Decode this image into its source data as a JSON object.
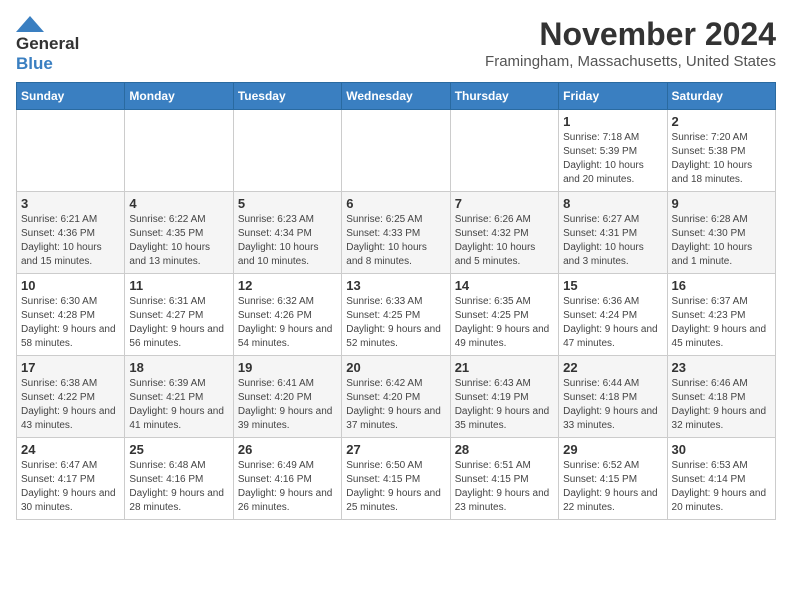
{
  "header": {
    "logo_line1": "General",
    "logo_line2": "Blue",
    "month_year": "November 2024",
    "location": "Framingham, Massachusetts, United States"
  },
  "weekdays": [
    "Sunday",
    "Monday",
    "Tuesday",
    "Wednesday",
    "Thursday",
    "Friday",
    "Saturday"
  ],
  "weeks": [
    [
      {
        "day": "",
        "sunrise": "",
        "sunset": "",
        "daylight": ""
      },
      {
        "day": "",
        "sunrise": "",
        "sunset": "",
        "daylight": ""
      },
      {
        "day": "",
        "sunrise": "",
        "sunset": "",
        "daylight": ""
      },
      {
        "day": "",
        "sunrise": "",
        "sunset": "",
        "daylight": ""
      },
      {
        "day": "",
        "sunrise": "",
        "sunset": "",
        "daylight": ""
      },
      {
        "day": "1",
        "sunrise": "Sunrise: 7:18 AM",
        "sunset": "Sunset: 5:39 PM",
        "daylight": "Daylight: 10 hours and 20 minutes."
      },
      {
        "day": "2",
        "sunrise": "Sunrise: 7:20 AM",
        "sunset": "Sunset: 5:38 PM",
        "daylight": "Daylight: 10 hours and 18 minutes."
      }
    ],
    [
      {
        "day": "3",
        "sunrise": "Sunrise: 6:21 AM",
        "sunset": "Sunset: 4:36 PM",
        "daylight": "Daylight: 10 hours and 15 minutes."
      },
      {
        "day": "4",
        "sunrise": "Sunrise: 6:22 AM",
        "sunset": "Sunset: 4:35 PM",
        "daylight": "Daylight: 10 hours and 13 minutes."
      },
      {
        "day": "5",
        "sunrise": "Sunrise: 6:23 AM",
        "sunset": "Sunset: 4:34 PM",
        "daylight": "Daylight: 10 hours and 10 minutes."
      },
      {
        "day": "6",
        "sunrise": "Sunrise: 6:25 AM",
        "sunset": "Sunset: 4:33 PM",
        "daylight": "Daylight: 10 hours and 8 minutes."
      },
      {
        "day": "7",
        "sunrise": "Sunrise: 6:26 AM",
        "sunset": "Sunset: 4:32 PM",
        "daylight": "Daylight: 10 hours and 5 minutes."
      },
      {
        "day": "8",
        "sunrise": "Sunrise: 6:27 AM",
        "sunset": "Sunset: 4:31 PM",
        "daylight": "Daylight: 10 hours and 3 minutes."
      },
      {
        "day": "9",
        "sunrise": "Sunrise: 6:28 AM",
        "sunset": "Sunset: 4:30 PM",
        "daylight": "Daylight: 10 hours and 1 minute."
      }
    ],
    [
      {
        "day": "10",
        "sunrise": "Sunrise: 6:30 AM",
        "sunset": "Sunset: 4:28 PM",
        "daylight": "Daylight: 9 hours and 58 minutes."
      },
      {
        "day": "11",
        "sunrise": "Sunrise: 6:31 AM",
        "sunset": "Sunset: 4:27 PM",
        "daylight": "Daylight: 9 hours and 56 minutes."
      },
      {
        "day": "12",
        "sunrise": "Sunrise: 6:32 AM",
        "sunset": "Sunset: 4:26 PM",
        "daylight": "Daylight: 9 hours and 54 minutes."
      },
      {
        "day": "13",
        "sunrise": "Sunrise: 6:33 AM",
        "sunset": "Sunset: 4:25 PM",
        "daylight": "Daylight: 9 hours and 52 minutes."
      },
      {
        "day": "14",
        "sunrise": "Sunrise: 6:35 AM",
        "sunset": "Sunset: 4:25 PM",
        "daylight": "Daylight: 9 hours and 49 minutes."
      },
      {
        "day": "15",
        "sunrise": "Sunrise: 6:36 AM",
        "sunset": "Sunset: 4:24 PM",
        "daylight": "Daylight: 9 hours and 47 minutes."
      },
      {
        "day": "16",
        "sunrise": "Sunrise: 6:37 AM",
        "sunset": "Sunset: 4:23 PM",
        "daylight": "Daylight: 9 hours and 45 minutes."
      }
    ],
    [
      {
        "day": "17",
        "sunrise": "Sunrise: 6:38 AM",
        "sunset": "Sunset: 4:22 PM",
        "daylight": "Daylight: 9 hours and 43 minutes."
      },
      {
        "day": "18",
        "sunrise": "Sunrise: 6:39 AM",
        "sunset": "Sunset: 4:21 PM",
        "daylight": "Daylight: 9 hours and 41 minutes."
      },
      {
        "day": "19",
        "sunrise": "Sunrise: 6:41 AM",
        "sunset": "Sunset: 4:20 PM",
        "daylight": "Daylight: 9 hours and 39 minutes."
      },
      {
        "day": "20",
        "sunrise": "Sunrise: 6:42 AM",
        "sunset": "Sunset: 4:20 PM",
        "daylight": "Daylight: 9 hours and 37 minutes."
      },
      {
        "day": "21",
        "sunrise": "Sunrise: 6:43 AM",
        "sunset": "Sunset: 4:19 PM",
        "daylight": "Daylight: 9 hours and 35 minutes."
      },
      {
        "day": "22",
        "sunrise": "Sunrise: 6:44 AM",
        "sunset": "Sunset: 4:18 PM",
        "daylight": "Daylight: 9 hours and 33 minutes."
      },
      {
        "day": "23",
        "sunrise": "Sunrise: 6:46 AM",
        "sunset": "Sunset: 4:18 PM",
        "daylight": "Daylight: 9 hours and 32 minutes."
      }
    ],
    [
      {
        "day": "24",
        "sunrise": "Sunrise: 6:47 AM",
        "sunset": "Sunset: 4:17 PM",
        "daylight": "Daylight: 9 hours and 30 minutes."
      },
      {
        "day": "25",
        "sunrise": "Sunrise: 6:48 AM",
        "sunset": "Sunset: 4:16 PM",
        "daylight": "Daylight: 9 hours and 28 minutes."
      },
      {
        "day": "26",
        "sunrise": "Sunrise: 6:49 AM",
        "sunset": "Sunset: 4:16 PM",
        "daylight": "Daylight: 9 hours and 26 minutes."
      },
      {
        "day": "27",
        "sunrise": "Sunrise: 6:50 AM",
        "sunset": "Sunset: 4:15 PM",
        "daylight": "Daylight: 9 hours and 25 minutes."
      },
      {
        "day": "28",
        "sunrise": "Sunrise: 6:51 AM",
        "sunset": "Sunset: 4:15 PM",
        "daylight": "Daylight: 9 hours and 23 minutes."
      },
      {
        "day": "29",
        "sunrise": "Sunrise: 6:52 AM",
        "sunset": "Sunset: 4:15 PM",
        "daylight": "Daylight: 9 hours and 22 minutes."
      },
      {
        "day": "30",
        "sunrise": "Sunrise: 6:53 AM",
        "sunset": "Sunset: 4:14 PM",
        "daylight": "Daylight: 9 hours and 20 minutes."
      }
    ]
  ]
}
